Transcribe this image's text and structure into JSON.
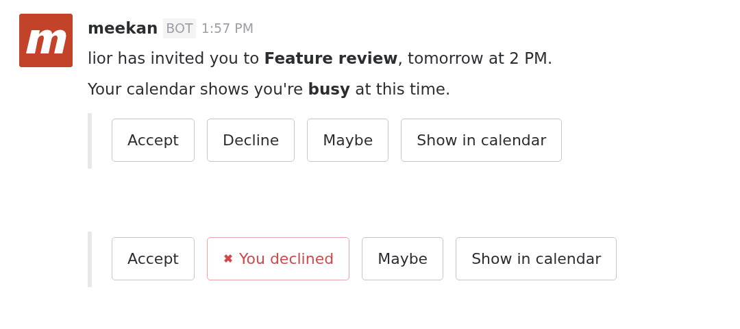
{
  "message": {
    "sender": "meekan",
    "badge": "BOT",
    "time": "1:57 PM",
    "lines": [
      "lior has invited you to **Feature review**, tomorrow at 2 PM.",
      "Your calendar shows you're **busy** at this time."
    ]
  },
  "attachments": [
    {
      "buttons": [
        {
          "label": "Accept",
          "declined": false
        },
        {
          "label": "Decline",
          "declined": false
        },
        {
          "label": "Maybe",
          "declined": false
        },
        {
          "label": "Show in calendar",
          "declined": false
        }
      ]
    },
    {
      "buttons": [
        {
          "label": "Accept",
          "declined": false
        },
        {
          "label": "You declined",
          "declined": true
        },
        {
          "label": "Maybe",
          "declined": false
        },
        {
          "label": "Show in calendar",
          "declined": false
        }
      ]
    }
  ]
}
